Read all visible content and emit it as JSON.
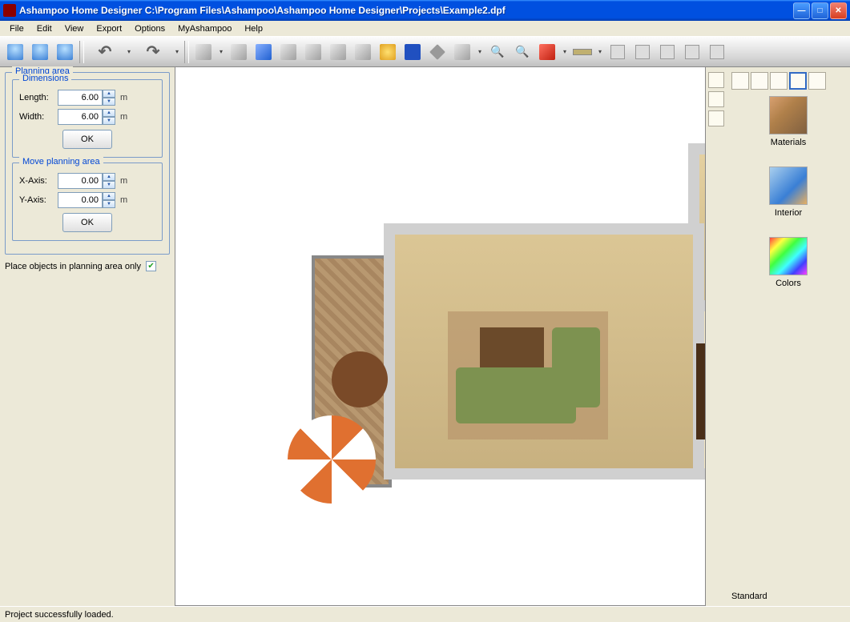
{
  "title": "Ashampoo Home Designer C:\\Program Files\\Ashampoo\\Ashampoo Home Designer\\Projects\\Example2.dpf",
  "menu": [
    "File",
    "Edit",
    "View",
    "Export",
    "Options",
    "MyAshampoo",
    "Help"
  ],
  "planning": {
    "title": "Planning area",
    "dimensions": {
      "title": "Dimensions",
      "length_label": "Length:",
      "length_value": "6.00",
      "width_label": "Width:",
      "width_value": "6.00",
      "unit": "m",
      "ok": "OK"
    },
    "move": {
      "title": "Move planning area",
      "x_label": "X-Axis:",
      "x_value": "0.00",
      "y_label": "Y-Axis:",
      "y_value": "0.00",
      "unit": "m",
      "ok": "OK"
    },
    "checkbox_label": "Place objects in planning area only"
  },
  "right_panel": {
    "categories": {
      "materials": "Materials",
      "interior": "Interior",
      "colors": "Colors"
    },
    "footer": "Standard"
  },
  "status": "Project successfully loaded."
}
